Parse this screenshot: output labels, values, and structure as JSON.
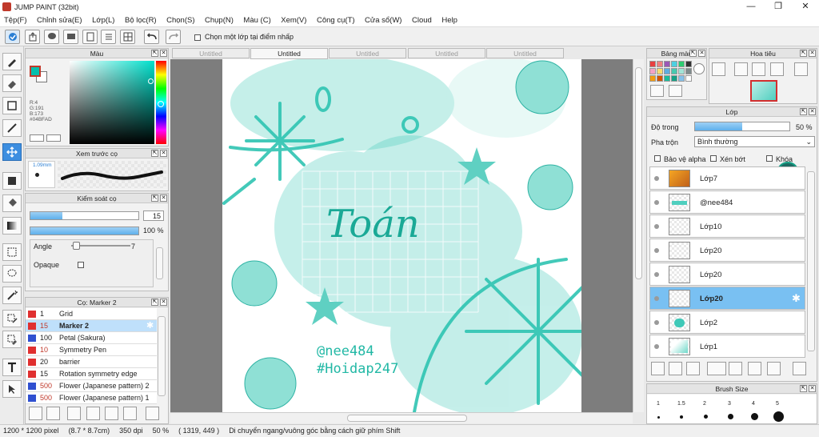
{
  "window": {
    "title": "JUMP PAINT (32bit)",
    "minimize": "—",
    "maximize": "❐",
    "close": "✕"
  },
  "menu": [
    "Tệp(F)",
    "Chỉnh sửa(E)",
    "Lớp(L)",
    "Bộ lọc(R)",
    "Chọn(S)",
    "Chụp(N)",
    "Màu (C)",
    "Xem(V)",
    "Công cụ(T)",
    "Cửa sổ(W)",
    "Cloud",
    "Help"
  ],
  "toolbar": {
    "select_one_layer": "Chọn một lớp tại điểm nhấp"
  },
  "color_panel": {
    "title": "Màu",
    "r": "R:4",
    "g": "G:191",
    "b": "B:173",
    "hex": "#04BFAD",
    "main_color": "#04bfad"
  },
  "brush_preview": {
    "title": "Xem trước cọ",
    "size": "1.09mm"
  },
  "brush_control": {
    "title": "Kiểm soát cọ",
    "size": "15",
    "opacity": "100 %",
    "angle_label": "Angle",
    "angle_value": "7",
    "opaque_label": "Opaque"
  },
  "brush_list": {
    "title": "Cọ: Marker 2",
    "items": [
      {
        "num": "1",
        "name": "Grid",
        "color": "#e03030"
      },
      {
        "num": "15",
        "name": "Marker 2",
        "color": "#e03030",
        "selected": true
      },
      {
        "num": "100",
        "name": "Petal (Sakura)",
        "color": "#3050d0"
      },
      {
        "num": "10",
        "name": "Symmetry Pen",
        "color": "#e03030"
      },
      {
        "num": "20",
        "name": "barrier",
        "color": "#e03030"
      },
      {
        "num": "15",
        "name": "Rotation symmetry edge",
        "color": "#e03030"
      },
      {
        "num": "500",
        "name": "Flower (Japanese pattern) 2",
        "color": "#3050d0"
      },
      {
        "num": "500",
        "name": "Flower (Japanese pattern) 1",
        "color": "#3050d0"
      }
    ]
  },
  "tabs": [
    "Untitled",
    "Untitled",
    "Untitled",
    "Untitled",
    "Untitled"
  ],
  "canvas": {
    "heading": "Toán",
    "handle1": "@nee484",
    "handle2": "#Hoidap247"
  },
  "swatches_panel": {
    "title": "Bảng màu",
    "colors": [
      "#e84040",
      "#f08080",
      "#9b59b6",
      "#4dd0e1",
      "#2ecc71",
      "#333333",
      "#f4a3c4",
      "#f7dc6f",
      "#5dade2",
      "#48c9b0",
      "#a3e4d7",
      "#7f8c8d",
      "#f39c12",
      "#d35400",
      "#1abc9c",
      "#16a085",
      "#85c1e9",
      "#ffffff"
    ]
  },
  "navigator": {
    "title": "Hoa tiêu"
  },
  "layer_panel": {
    "title": "Lớp",
    "opacity_label": "Độ trong",
    "opacity_value": "50 %",
    "opacity_fraction": 0.5,
    "blend_label": "Pha trộn",
    "blend_value": "Bình thường",
    "protect_alpha": "Bảo vệ alpha",
    "clip": "Xén bớt",
    "lock": "Khóa",
    "layers": [
      {
        "name": "Lớp7",
        "thumb": "orange"
      },
      {
        "name": "@nee484",
        "thumb": "text"
      },
      {
        "name": "Lớp10",
        "thumb": "blank"
      },
      {
        "name": "Lớp20",
        "thumb": "blank"
      },
      {
        "name": "Lớp20",
        "thumb": "blank"
      },
      {
        "name": "Lớp20",
        "thumb": "blank",
        "selected": true
      },
      {
        "name": "Lớp2",
        "thumb": "teal"
      },
      {
        "name": "Lớp1",
        "thumb": "teal-light"
      }
    ]
  },
  "brush_size": {
    "title": "Brush Size",
    "sizes": [
      "1",
      "1.5",
      "2",
      "3",
      "4",
      "5"
    ]
  },
  "status": {
    "dims": "1200 * 1200 pixel",
    "size_cm": "(8.7 * 8.7cm)",
    "dpi": "350 dpi",
    "zoom": "50 %",
    "coords": "( 1319, 449 )",
    "hint": "Di chuyển ngang/vuông góc bằng cách giữ phím Shift"
  }
}
